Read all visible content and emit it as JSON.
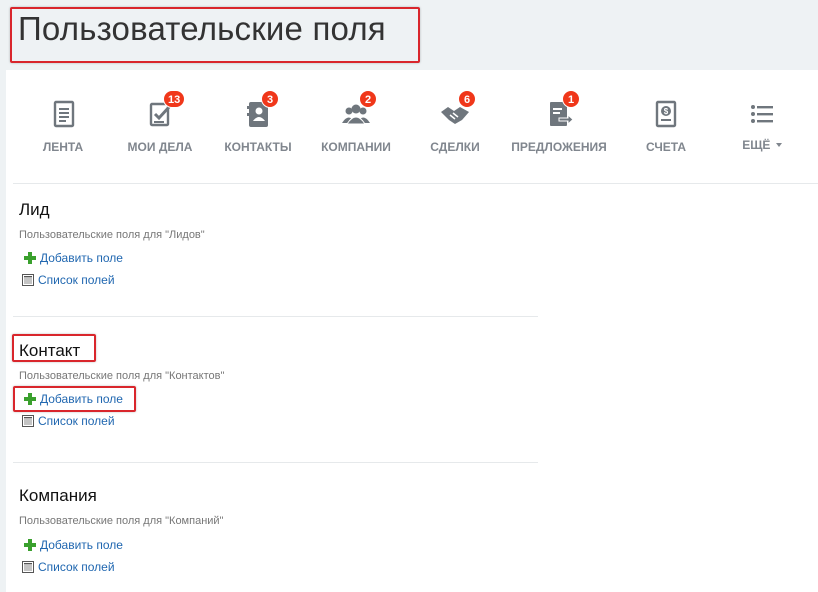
{
  "page": {
    "title": "Пользовательские поля"
  },
  "nav": {
    "items": [
      {
        "label": "ЛЕНТА",
        "icon": "feed-icon",
        "badge": null
      },
      {
        "label": "МОИ ДЕЛА",
        "icon": "tasks-icon",
        "badge": "13"
      },
      {
        "label": "КОНТАКТЫ",
        "icon": "contacts-icon",
        "badge": "3"
      },
      {
        "label": "КОМПАНИИ",
        "icon": "companies-icon",
        "badge": "2"
      },
      {
        "label": "СДЕЛКИ",
        "icon": "deals-icon",
        "badge": "6"
      },
      {
        "label": "ПРЕДЛОЖЕНИЯ",
        "icon": "quotes-icon",
        "badge": "1"
      },
      {
        "label": "СЧЕТА",
        "icon": "invoices-icon",
        "badge": null
      },
      {
        "label": "ЕЩЁ",
        "icon": "more-icon",
        "badge": null
      }
    ]
  },
  "sections": [
    {
      "title": "Лид",
      "subtitle": "Пользовательские поля для \"Лидов\"",
      "add_label": "Добавить поле",
      "list_label": "Список полей"
    },
    {
      "title": "Контакт",
      "subtitle": "Пользовательские поля для \"Контактов\"",
      "add_label": "Добавить поле",
      "list_label": "Список полей"
    },
    {
      "title": "Компания",
      "subtitle": "Пользовательские поля для \"Компаний\"",
      "add_label": "Добавить поле",
      "list_label": "Список полей"
    }
  ],
  "colors": {
    "highlight": "#d9262c",
    "link": "#2067b0",
    "badge": "#f0371a",
    "icon": "#6f767d",
    "add": "#3aa02d"
  }
}
